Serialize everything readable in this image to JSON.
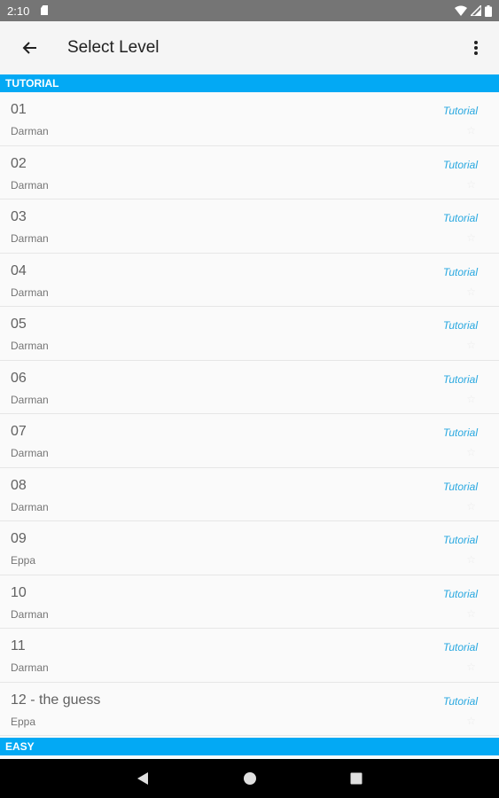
{
  "status_bar": {
    "time": "2:10"
  },
  "app_bar": {
    "title": "Select Level"
  },
  "sections": {
    "tutorial": "TUTORIAL",
    "easy": "EASY"
  },
  "levels": [
    {
      "name": "01",
      "author": "Darman",
      "tag": "Tutorial"
    },
    {
      "name": "02",
      "author": "Darman",
      "tag": "Tutorial"
    },
    {
      "name": "03",
      "author": "Darman",
      "tag": "Tutorial"
    },
    {
      "name": "04",
      "author": "Darman",
      "tag": "Tutorial"
    },
    {
      "name": "05",
      "author": "Darman",
      "tag": "Tutorial"
    },
    {
      "name": "06",
      "author": "Darman",
      "tag": "Tutorial"
    },
    {
      "name": "07",
      "author": "Darman",
      "tag": "Tutorial"
    },
    {
      "name": "08",
      "author": "Darman",
      "tag": "Tutorial"
    },
    {
      "name": "09",
      "author": "Eppa",
      "tag": "Tutorial"
    },
    {
      "name": "10",
      "author": "Darman",
      "tag": "Tutorial"
    },
    {
      "name": "11",
      "author": "Darman",
      "tag": "Tutorial"
    },
    {
      "name": "12 - the guess",
      "author": "Eppa",
      "tag": "Tutorial"
    }
  ],
  "icons": {
    "back": "arrow-back-icon",
    "overflow": "more-vert-icon",
    "star": "star-icon",
    "wifi": "wifi-icon",
    "signal": "signal-icon",
    "battery": "battery-icon",
    "sd_card": "sd-card-icon"
  },
  "colors": {
    "section_header": "#03a9f4",
    "tag_text": "#29a8e0",
    "status_bar": "#757575",
    "nav_bar": "#000000"
  }
}
